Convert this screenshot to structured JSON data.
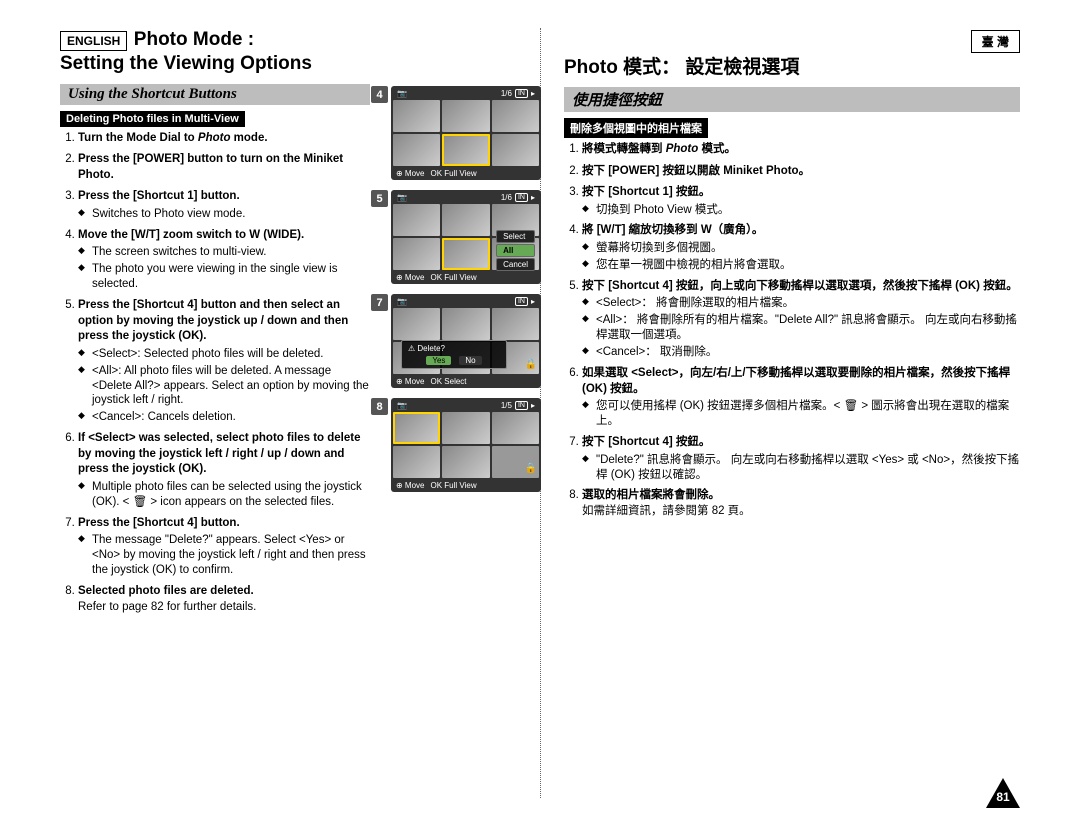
{
  "left": {
    "lang_label": "ENGLISH",
    "title_line1": "Photo Mode :",
    "title_line2": "Setting the Viewing Options",
    "subtitle": "Using the Shortcut Buttons",
    "section": "Deleting Photo files in Multi-View",
    "steps": [
      {
        "b": "Turn the Mode Dial to ",
        "i": "Photo",
        "b2": " mode."
      },
      {
        "b": "Press the [POWER] button to turn on the Miniket Photo."
      },
      {
        "b": "Press the [Shortcut 1] button.",
        "sub": [
          "Switches to Photo view mode."
        ]
      },
      {
        "b": "Move the [W/T] zoom switch to W (WIDE).",
        "sub": [
          "The screen switches to multi-view.",
          "The photo you were viewing in the single view is selected."
        ]
      },
      {
        "b": "Press the [Shortcut 4] button and then select an option by moving the joystick up / down and then press the joystick (OK).",
        "sub": [
          "<Select>: Selected photo files will be deleted.",
          "<All>: All photo files will be deleted. A message <Delete All?> appears. Select an option by moving the joystick left / right.",
          "<Cancel>: Cancels deletion."
        ]
      },
      {
        "b": "If <Select> was selected, select photo files to delete by moving the joystick left / right / up / down and press the joystick (OK).",
        "sub": [
          "Multiple photo files can be selected using the joystick (OK). < 🗑 > icon appears on the selected files."
        ]
      },
      {
        "b": "Press the [Shortcut 4] button.",
        "sub": [
          "The message \"Delete?\" appears. Select <Yes> or <No> by moving the joystick left / right and then press the joystick (OK) to confirm."
        ]
      },
      {
        "b": "Selected photo files are deleted.",
        "plain": "Refer to page 82 for further details."
      }
    ]
  },
  "right": {
    "lang_label": "臺 灣",
    "title": "Photo 模式： 設定檢視選項",
    "subtitle": "使用捷徑按鈕",
    "section": "刪除多個視圖中的相片檔案",
    "steps": [
      {
        "b": "將模式轉盤轉到 ",
        "i": "Photo",
        "b2": " 模式。"
      },
      {
        "b": "按下 [POWER] 按鈕以開啟 Miniket Photo。"
      },
      {
        "b": "按下 [Shortcut 1] 按鈕。",
        "sub": [
          "切換到 Photo View 模式。"
        ]
      },
      {
        "b": "將 [W/T] 縮放切換移到 W（廣角）。",
        "sub": [
          "螢幕將切換到多個視圖。",
          "您在單一視圖中檢視的相片將會選取。"
        ]
      },
      {
        "b": "按下 [Shortcut 4] 按鈕，向上或向下移動搖桿以選取選項，然後按下搖桿 (OK) 按鈕。",
        "sub": [
          "<Select>： 將會刪除選取的相片檔案。",
          "<All>： 將會刪除所有的相片檔案。\"Delete All?\" 訊息將會顯示。 向左或向右移動搖桿選取一個選項。",
          "<Cancel>： 取消刪除。"
        ]
      },
      {
        "b": "如果選取 <Select>，向左/右/上/下移動搖桿以選取要刪除的相片檔案，然後按下搖桿 (OK) 按鈕。",
        "sub": [
          "您可以使用搖桿 (OK) 按鈕選擇多個相片檔案。< 🗑 > 圖示將會出現在選取的檔案上。"
        ]
      },
      {
        "b": "按下 [Shortcut 4] 按鈕。",
        "sub": [
          "\"Delete?\" 訊息將會顯示。 向左或向右移動搖桿以選取 <Yes> 或 <No>，然後按下搖桿 (OK) 按鈕以確認。"
        ]
      },
      {
        "b": "選取的相片檔案將會刪除。",
        "plain": "如需詳細資訊，請參閱第 82 頁。"
      }
    ]
  },
  "screens": [
    {
      "step": "4",
      "count": "1/6",
      "menu": null,
      "bottom": [
        "⊕ Move",
        "OK Full View"
      ],
      "select_idx": 4
    },
    {
      "step": "5",
      "count": "1/6",
      "menu": [
        "Select",
        "All",
        "Cancel"
      ],
      "hl": 1,
      "bottom": [
        "⊕ Move",
        "OK Full View"
      ],
      "select_idx": 4
    },
    {
      "step": "7",
      "count": "",
      "dialog": {
        "q": "Delete?",
        "y": "Yes",
        "n": "No"
      },
      "bottom": [
        "⊕ Move",
        "OK Select"
      ],
      "lock": true
    },
    {
      "step": "8",
      "count": "1/5",
      "bottom": [
        "⊕ Move",
        "OK Full View"
      ],
      "lock": true,
      "select_idx": 0
    }
  ],
  "page_number": "81"
}
